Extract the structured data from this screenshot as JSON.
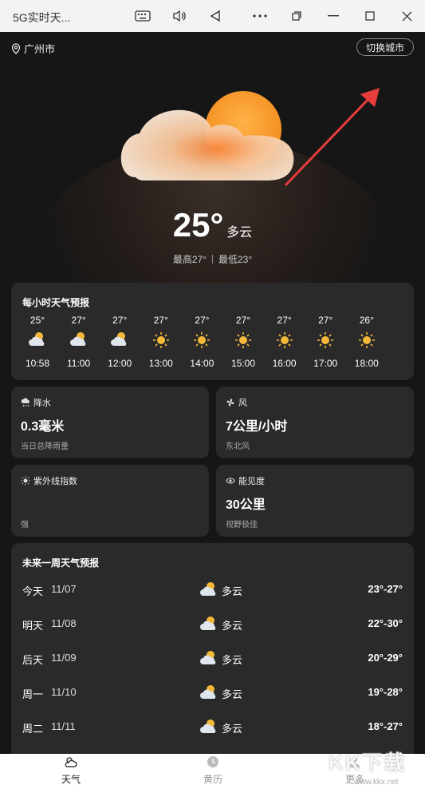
{
  "window": {
    "title": "5G实时天..."
  },
  "header": {
    "location": "广州市",
    "switch_label": "切换城市"
  },
  "current": {
    "temp": "25°",
    "condition": "多云",
    "high": "最高27°",
    "low": "最低23°"
  },
  "hourly": {
    "title": "每小时天气预报",
    "items": [
      {
        "temp": "25°",
        "icon": "partly-cloudy-icon",
        "time": "10:58"
      },
      {
        "temp": "27°",
        "icon": "partly-cloudy-icon",
        "time": "11:00"
      },
      {
        "temp": "27°",
        "icon": "partly-cloudy-icon",
        "time": "12:00"
      },
      {
        "temp": "27°",
        "icon": "sun-icon",
        "time": "13:00"
      },
      {
        "temp": "27°",
        "icon": "sun-icon",
        "time": "14:00"
      },
      {
        "temp": "27°",
        "icon": "sun-icon",
        "time": "15:00"
      },
      {
        "temp": "27°",
        "icon": "sun-icon",
        "time": "16:00"
      },
      {
        "temp": "27°",
        "icon": "sun-icon",
        "time": "17:00"
      },
      {
        "temp": "26°",
        "icon": "sun-icon",
        "time": "18:00"
      }
    ]
  },
  "precip": {
    "label": "降水",
    "value": "0.3毫米",
    "sub": "当日总降雨量"
  },
  "wind": {
    "label": "风",
    "value": "7公里/小时",
    "sub": "东北风"
  },
  "uv": {
    "label": "紫外线指数",
    "sub": "强"
  },
  "visibility": {
    "label": "能见度",
    "value": "30公里",
    "sub": "视野极佳"
  },
  "weekly": {
    "title": "未来一周天气预报",
    "items": [
      {
        "day": "今天",
        "date": "11/07",
        "cond": "多云",
        "range": "23°-27°"
      },
      {
        "day": "明天",
        "date": "11/08",
        "cond": "多云",
        "range": "22°-30°"
      },
      {
        "day": "后天",
        "date": "11/09",
        "cond": "多云",
        "range": "20°-29°"
      },
      {
        "day": "周一",
        "date": "11/10",
        "cond": "多云",
        "range": "19°-28°"
      },
      {
        "day": "周二",
        "date": "11/11",
        "cond": "多云",
        "range": "18°-27°"
      }
    ]
  },
  "nav": {
    "weather": "天气",
    "almanac": "黄历",
    "more": "更多"
  },
  "watermark": {
    "text": "KK下载",
    "url": "www.kkx.net"
  }
}
